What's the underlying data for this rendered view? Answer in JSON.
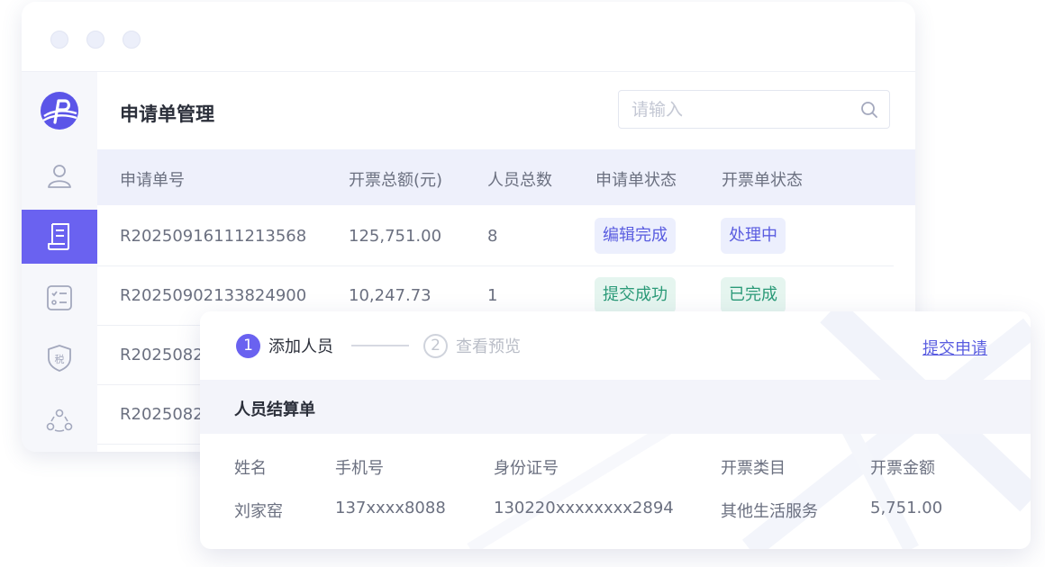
{
  "page": {
    "title": "申请单管理"
  },
  "search": {
    "placeholder": "请输入"
  },
  "table": {
    "columns": [
      "申请单号",
      "开票总额(元)",
      "人员总数",
      "申请单状态",
      "开票单状态"
    ],
    "rows": [
      {
        "id": "R20250916111213568",
        "amount": "125,751.00",
        "count": "8",
        "app_status": "编辑完成",
        "inv_status": "处理中"
      },
      {
        "id": "R20250902133824900",
        "amount": "10,247.73",
        "count": "1",
        "app_status": "提交成功",
        "inv_status": "已完成"
      },
      {
        "id": "R2025082"
      },
      {
        "id": "R2025082"
      }
    ]
  },
  "steps": [
    {
      "num": "1",
      "label": "添加人员"
    },
    {
      "num": "2",
      "label": "查看预览"
    }
  ],
  "actions": {
    "submit": "提交申请"
  },
  "settlement": {
    "title": "人员结算单",
    "columns": [
      "姓名",
      "手机号",
      "身份证号",
      "开票类目",
      "开票金额"
    ],
    "row": {
      "name": "刘家窑",
      "phone": "137xxxx8088",
      "idcard": "130220xxxxxxxx2894",
      "category": "其他生活服务",
      "amount": "5,751.00"
    }
  },
  "sidebar": {
    "icons": [
      "logo-icon",
      "user-icon",
      "invoice-icon",
      "checklist-icon",
      "tax-shield-icon",
      "team-icon"
    ],
    "tax_badge": "税"
  },
  "colors": {
    "accent": "#6a62f0",
    "tag_blue_bg": "#eceffd",
    "tag_green_bg": "#e5f5ef",
    "link": "#5a5de0"
  }
}
